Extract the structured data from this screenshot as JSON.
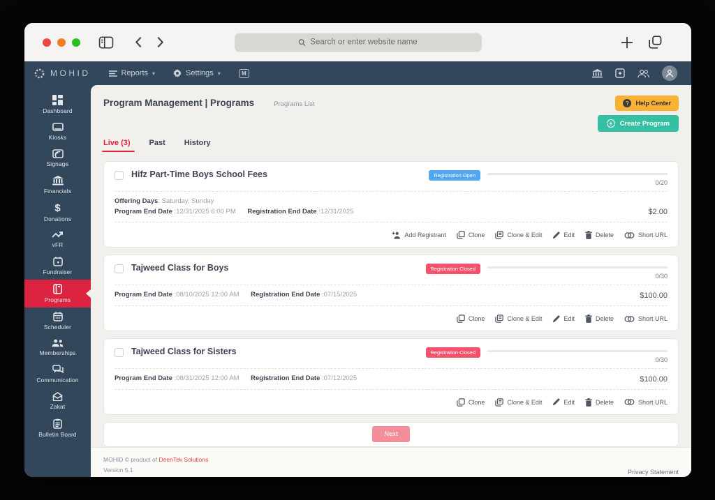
{
  "colors": {
    "navbar_bg": "#33475c",
    "sidebar_active_red": "#dc2440",
    "tab_active_red": "#e0243f",
    "badge_open_blue": "#51a7f0",
    "badge_closed_red": "#f4516c",
    "help_center_orange": "#f9b233",
    "create_program_teal": "#35bfa3",
    "next_button_pink": "#f28e9a"
  },
  "browser": {
    "search_placeholder": "Search or enter website name"
  },
  "navbar": {
    "brand": "MOHID",
    "reports_label": "Reports",
    "settings_label": "Settings"
  },
  "sidebar": {
    "items": [
      {
        "label": "Dashboard"
      },
      {
        "label": "Kiosks"
      },
      {
        "label": "Signage"
      },
      {
        "label": "Financials"
      },
      {
        "label": "Donations"
      },
      {
        "label": "vFR"
      },
      {
        "label": "Fundraiser"
      },
      {
        "label": "Programs",
        "active": true
      },
      {
        "label": "Scheduler"
      },
      {
        "label": "Memberships"
      },
      {
        "label": "Communication"
      },
      {
        "label": "Zakat"
      },
      {
        "label": "Bulletin Board"
      }
    ]
  },
  "header": {
    "title": "Program Management | Programs",
    "breadcrumb": "Programs List",
    "help_center_label": "Help Center",
    "create_program_label": "Create Program"
  },
  "tabs": {
    "live": "Live (3)",
    "past": "Past",
    "history": "History"
  },
  "programs": [
    {
      "title": "Hifz Part-Time Boys School Fees",
      "badge": "Registration Open",
      "count": "0/20",
      "price": "$2.00",
      "offering_days_label": "Offering Days",
      "offering_days_value": ": Saturday, Sunday",
      "end_date_label": "Program End Date",
      "end_date_value": ":12/31/2025 6:00 PM",
      "reg_end_label": "Registration End Date",
      "reg_end_value": ":12/31/2025"
    },
    {
      "title": "Tajweed Class for Boys",
      "badge": "Registration Closed",
      "count": "0/30",
      "price": "$100.00",
      "end_date_label": "Program End Date",
      "end_date_value": ":08/10/2025 12:00 AM",
      "reg_end_label": "Registration End Date",
      "reg_end_value": ":07/15/2025"
    },
    {
      "title": "Tajweed Class for Sisters",
      "badge": "Registration Closed",
      "count": "0/30",
      "price": "$100.00",
      "end_date_label": "Program End Date",
      "end_date_value": ":08/31/2025 12:00 AM",
      "reg_end_label": "Registration End Date",
      "reg_end_value": ":07/12/2025"
    }
  ],
  "actions": {
    "add_registrant": "Add Registrant",
    "clone": "Clone",
    "clone_edit": "Clone & Edit",
    "edit": "Edit",
    "delete": "Delete",
    "short_url": "Short URL"
  },
  "pagination": {
    "next_label": "Next"
  },
  "footer": {
    "product_prefix": "MOHID © product of",
    "company": "DeenTek Solutions",
    "version": "Version 5.1",
    "privacy": "Privacy Statement"
  }
}
